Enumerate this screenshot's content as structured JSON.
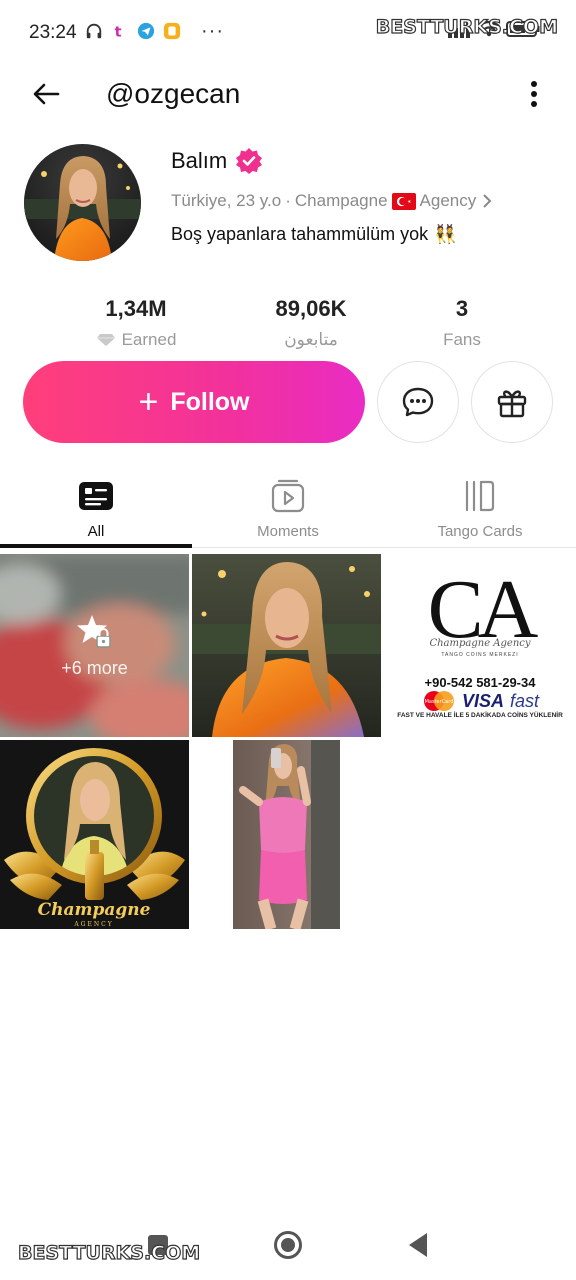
{
  "status_bar": {
    "time": "23:24",
    "icons": [
      "headphones-icon",
      "tango-app-icon",
      "telegram-icon",
      "yellow-app-icon"
    ],
    "overflow": "···",
    "watermark": "BESTTURKS.COM"
  },
  "header": {
    "handle": "@ozgecan"
  },
  "profile": {
    "display_name": "Balım",
    "verified": true,
    "meta_location": "Türkiye, 23 y.o",
    "meta_separator": "·",
    "meta_agency_1": "Champagne",
    "meta_agency_2": "Agency",
    "bio": "Boş yapanlara tahammülüm yok",
    "bio_emoji": "👯"
  },
  "stats": [
    {
      "value": "1,34M",
      "label": "Earned"
    },
    {
      "value": "89,06K",
      "label": "متابعون"
    },
    {
      "value": "3",
      "label": "Fans"
    }
  ],
  "actions": {
    "follow_plus": "+",
    "follow_label": "Follow"
  },
  "tabs": [
    {
      "label": "All",
      "active": true
    },
    {
      "label": "Moments",
      "active": false
    },
    {
      "label": "Tango Cards",
      "active": false
    }
  ],
  "grid": {
    "locked_tile_text": "+6 more",
    "agency_card": {
      "logo_letters": "CA",
      "logo_script": "Champagne Agency",
      "logo_sub": "TANGO COINS MERKEZI",
      "phone": "+90-542 581-29-34",
      "card_brands": [
        "MasterCard",
        "VISA",
        "fast"
      ],
      "footer": "FAST VE HAVALE İLE 5 DAKİKADA COİNS YÜKLENİR"
    },
    "badge_tile": {
      "script": "Champagne",
      "sub": "AGENCY"
    }
  },
  "colors": {
    "accent_start": "#ff3f7a",
    "accent_end": "#e92cc4",
    "verified": "#f0308f"
  },
  "bottom_watermark": "BESTTURKS.COM"
}
